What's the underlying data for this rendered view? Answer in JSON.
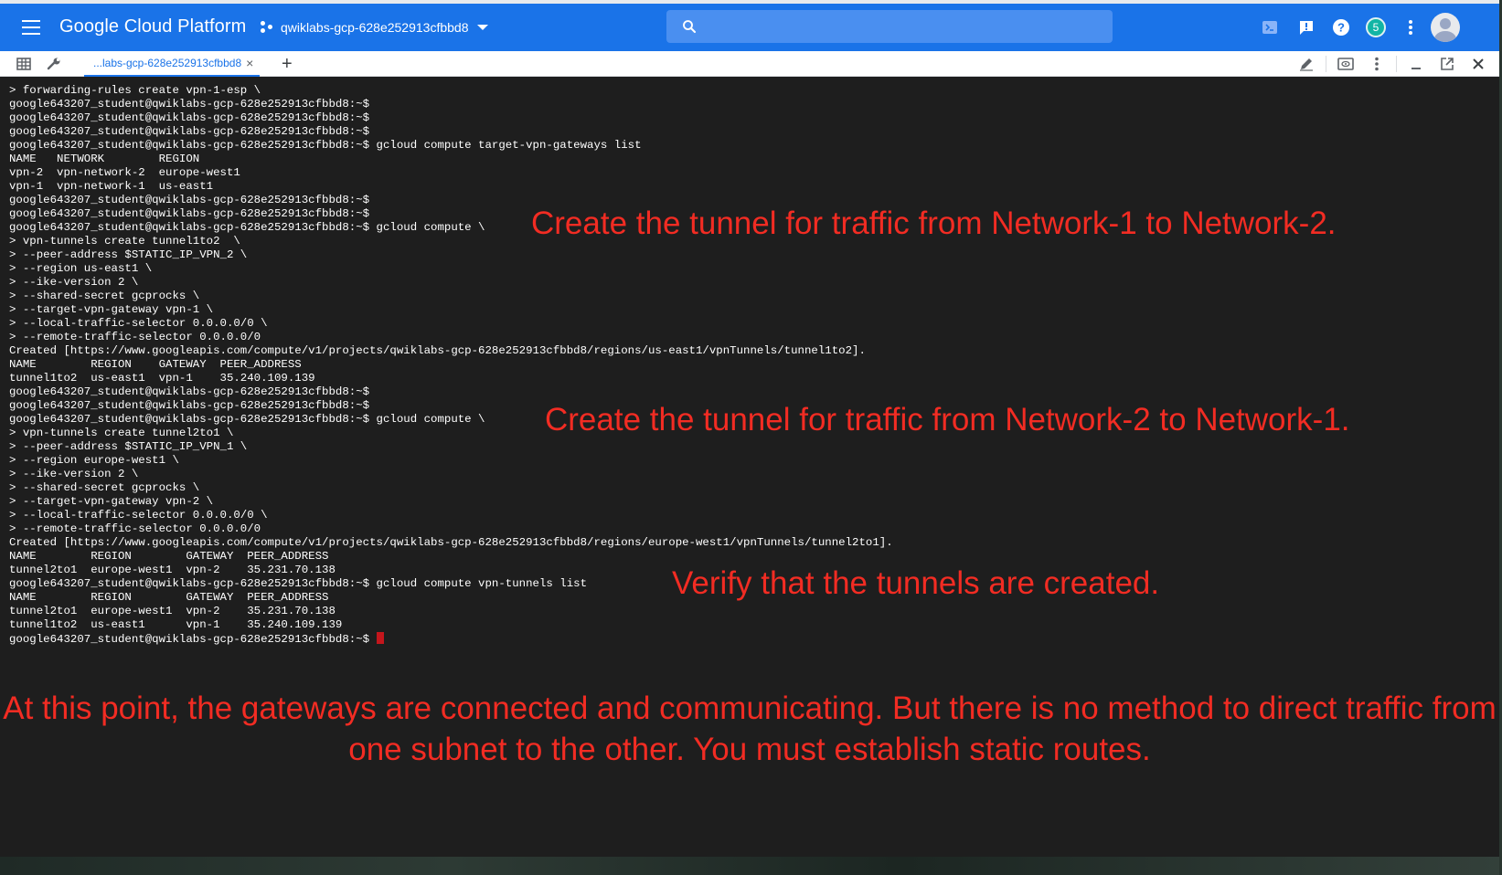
{
  "app": {
    "brand": "Google Cloud Platform",
    "project": "qwiklabs-gcp-628e252913cfbbd8",
    "notification_count": "5",
    "colors": {
      "appbar": "#1a73e8",
      "terminal_bg": "#1e1e1e",
      "annotation": "#f22c23",
      "cursor": "#c4161c"
    }
  },
  "tabbar": {
    "active_tab": "...labs-gcp-628e252913cfbbd8",
    "close_glyph": "×",
    "add_glyph": "+"
  },
  "terminal": {
    "lines": [
      "> forwarding-rules create vpn-1-esp \\",
      "google643207_student@qwiklabs-gcp-628e252913cfbbd8:~$",
      "google643207_student@qwiklabs-gcp-628e252913cfbbd8:~$",
      "google643207_student@qwiklabs-gcp-628e252913cfbbd8:~$",
      "google643207_student@qwiklabs-gcp-628e252913cfbbd8:~$ gcloud compute target-vpn-gateways list",
      "NAME   NETWORK        REGION",
      "vpn-2  vpn-network-2  europe-west1",
      "vpn-1  vpn-network-1  us-east1",
      "google643207_student@qwiklabs-gcp-628e252913cfbbd8:~$",
      "google643207_student@qwiklabs-gcp-628e252913cfbbd8:~$",
      "google643207_student@qwiklabs-gcp-628e252913cfbbd8:~$ gcloud compute \\",
      "> vpn-tunnels create tunnel1to2  \\",
      "> --peer-address $STATIC_IP_VPN_2 \\",
      "> --region us-east1 \\",
      "> --ike-version 2 \\",
      "> --shared-secret gcprocks \\",
      "> --target-vpn-gateway vpn-1 \\",
      "> --local-traffic-selector 0.0.0.0/0 \\",
      "> --remote-traffic-selector 0.0.0.0/0",
      "Created [https://www.googleapis.com/compute/v1/projects/qwiklabs-gcp-628e252913cfbbd8/regions/us-east1/vpnTunnels/tunnel1to2].",
      "NAME        REGION    GATEWAY  PEER_ADDRESS",
      "tunnel1to2  us-east1  vpn-1    35.240.109.139",
      "google643207_student@qwiklabs-gcp-628e252913cfbbd8:~$",
      "google643207_student@qwiklabs-gcp-628e252913cfbbd8:~$",
      "google643207_student@qwiklabs-gcp-628e252913cfbbd8:~$ gcloud compute \\",
      "> vpn-tunnels create tunnel2to1 \\",
      "> --peer-address $STATIC_IP_VPN_1 \\",
      "> --region europe-west1 \\",
      "> --ike-version 2 \\",
      "> --shared-secret gcprocks \\",
      "> --target-vpn-gateway vpn-2 \\",
      "> --local-traffic-selector 0.0.0.0/0 \\",
      "> --remote-traffic-selector 0.0.0.0/0",
      "Created [https://www.googleapis.com/compute/v1/projects/qwiklabs-gcp-628e252913cfbbd8/regions/europe-west1/vpnTunnels/tunnel2to1].",
      "NAME        REGION        GATEWAY  PEER_ADDRESS",
      "tunnel2to1  europe-west1  vpn-2    35.231.70.138",
      "google643207_student@qwiklabs-gcp-628e252913cfbbd8:~$ gcloud compute vpn-tunnels list",
      "NAME        REGION        GATEWAY  PEER_ADDRESS",
      "tunnel2to1  europe-west1  vpn-2    35.231.70.138",
      "tunnel1to2  us-east1      vpn-1    35.240.109.139",
      "google643207_student@qwiklabs-gcp-628e252913cfbbd8:~$ "
    ]
  },
  "annotations": {
    "tunnel_1_to_2": "Create the tunnel for traffic from Network-1 to Network-2.",
    "tunnel_2_to_1": "Create the tunnel for traffic from Network-2 to Network-1.",
    "verify": "Verify that the tunnels are created.",
    "summary": "At this point, the gateways are connected and communicating. But there is no method to direct traffic from one subnet to the other. You must establish static routes."
  },
  "icons": {
    "topbar": [
      "menu-icon",
      "project-icon",
      "search-icon",
      "cloud-shell-icon",
      "feedback-icon",
      "help-icon",
      "notifications-badge",
      "more-vert-icon",
      "account-avatar"
    ],
    "tabbar": [
      "grid-icon",
      "wrench-icon",
      "pencil-icon",
      "preview-icon",
      "more-vert-icon",
      "minimize-icon",
      "open-new-window-icon",
      "close-icon"
    ]
  }
}
